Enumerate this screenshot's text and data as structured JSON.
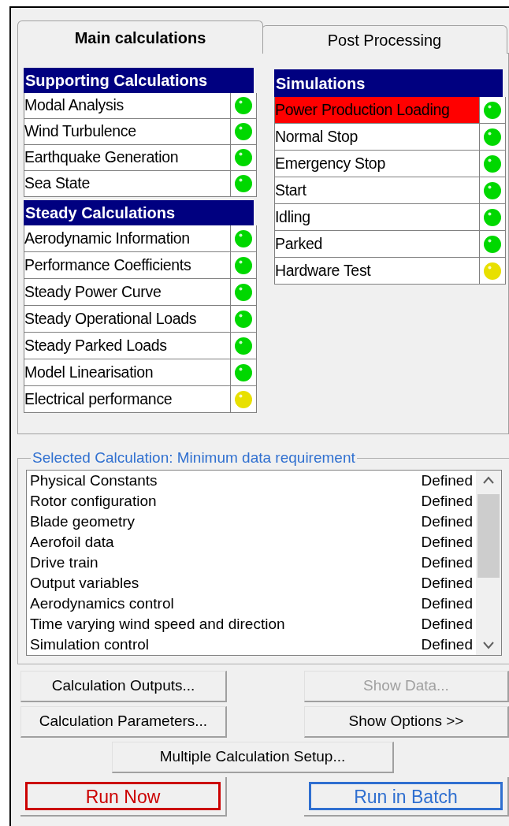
{
  "tabs": [
    {
      "label": "Main calculations",
      "selected": true
    },
    {
      "label": "Post Processing",
      "selected": false
    }
  ],
  "supporting": {
    "title": "Supporting Calculations",
    "items": [
      {
        "label": "Modal Analysis",
        "selected": false,
        "color": "#00d800"
      },
      {
        "label": "Wind Turbulence",
        "selected": false,
        "color": "#00d800"
      },
      {
        "label": "Earthquake Generation",
        "selected": false,
        "color": "#00d800"
      },
      {
        "label": "Sea State",
        "selected": false,
        "color": "#00d800"
      }
    ]
  },
  "steady": {
    "title": "Steady Calculations",
    "items": [
      {
        "label": "Aerodynamic Information",
        "selected": false,
        "color": "#00d800"
      },
      {
        "label": "Performance Coefficients",
        "selected": false,
        "color": "#00d800"
      },
      {
        "label": "Steady Power Curve",
        "selected": false,
        "color": "#00d800"
      },
      {
        "label": "Steady Operational Loads",
        "selected": false,
        "color": "#00d800"
      },
      {
        "label": "Steady Parked Loads",
        "selected": false,
        "color": "#00d800"
      },
      {
        "label": "Model Linearisation",
        "selected": false,
        "color": "#00d800"
      },
      {
        "label": "Electrical performance",
        "selected": false,
        "color": "#e8e000"
      }
    ]
  },
  "simulations": {
    "title": "Simulations",
    "items": [
      {
        "label": "Power Production Loading",
        "selected": true,
        "color": "#00d800"
      },
      {
        "label": "Normal Stop",
        "selected": false,
        "color": "#00d800"
      },
      {
        "label": "Emergency Stop",
        "selected": false,
        "color": "#00d800"
      },
      {
        "label": "Start",
        "selected": false,
        "color": "#00d800"
      },
      {
        "label": "Idling",
        "selected": false,
        "color": "#00d800"
      },
      {
        "label": "Parked",
        "selected": false,
        "color": "#00d800"
      },
      {
        "label": "Hardware Test",
        "selected": false,
        "color": "#e8e000"
      }
    ]
  },
  "requirements": {
    "title": "Selected Calculation: Minimum data requirement",
    "rows": [
      {
        "name": "Physical Constants",
        "status": "Defined"
      },
      {
        "name": "Rotor configuration",
        "status": "Defined"
      },
      {
        "name": "Blade geometry",
        "status": "Defined"
      },
      {
        "name": "Aerofoil data",
        "status": "Defined"
      },
      {
        "name": "Drive train",
        "status": "Defined"
      },
      {
        "name": "Output variables",
        "status": "Defined"
      },
      {
        "name": "Aerodynamics control",
        "status": "Defined"
      },
      {
        "name": "Time varying wind speed and direction",
        "status": "Defined"
      },
      {
        "name": "Simulation control",
        "status": "Defined"
      }
    ]
  },
  "buttons": [
    {
      "label": "Calculation Outputs...",
      "kind": "normal",
      "disabled": false
    },
    {
      "label": "Show Data...",
      "kind": "normal",
      "disabled": true
    },
    {
      "label": "Calculation Parameters...",
      "kind": "normal",
      "disabled": false
    },
    {
      "label": "Show Options >>",
      "kind": "normal",
      "disabled": false
    },
    {
      "label": "Multiple Calculation Setup...",
      "kind": "wide",
      "disabled": false
    },
    {
      "label": "Run Now",
      "kind": "run",
      "color": "#cc0000"
    },
    {
      "label": "Run in Batch",
      "kind": "run",
      "color": "#2f6fd0"
    }
  ]
}
